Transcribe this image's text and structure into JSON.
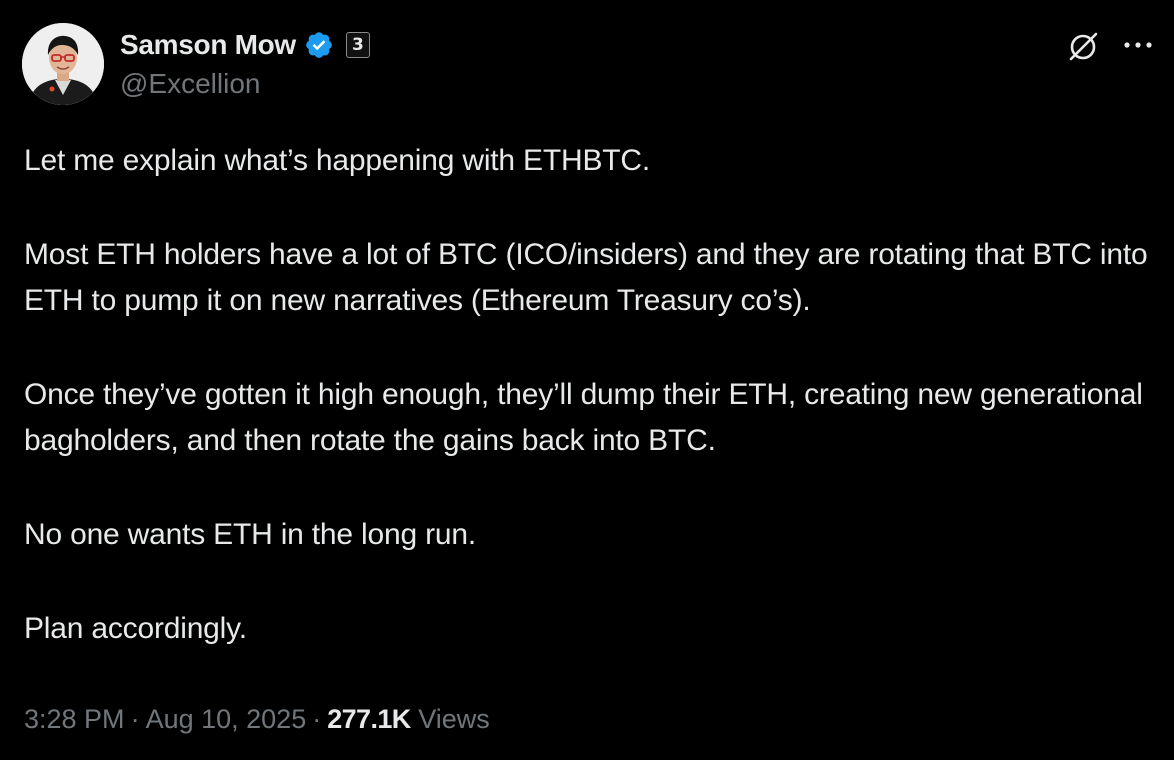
{
  "author": {
    "display_name": "Samson Mow",
    "handle": "@Excellion",
    "verified_icon": "verified-badge-icon",
    "affiliate_badge": "3",
    "avatar_icon": "profile-avatar"
  },
  "header_actions": {
    "grok_icon": "grok-icon",
    "more_icon": "more-options-icon"
  },
  "tweet": {
    "paragraphs": [
      "Let me explain what’s happening with ETHBTC.",
      "Most ETH holders have a lot of BTC (ICO/insiders) and they are rotating that BTC into ETH to pump it on new narratives (Ethereum Treasury co’s).",
      "Once they’ve gotten it high enough, they’ll dump their ETH, creating new generational bagholders, and then rotate the gains back into BTC.",
      "No one wants ETH in the long run.",
      "Plan accordingly."
    ]
  },
  "meta": {
    "time": "3:28 PM",
    "separator": "·",
    "date": "Aug 10, 2025",
    "views_count": "277.1K",
    "views_label": "Views"
  },
  "colors": {
    "background": "#000000",
    "primary_text": "#e7e9ea",
    "secondary_text": "#71767b",
    "verified_blue": "#1d9bf0"
  }
}
